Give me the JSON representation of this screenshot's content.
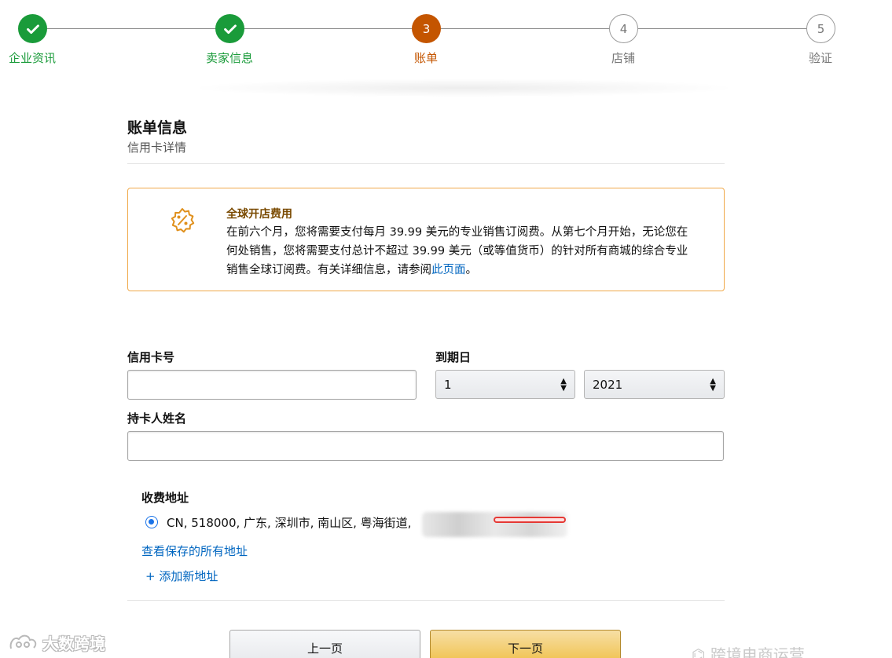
{
  "stepper": {
    "steps": [
      {
        "number": "1",
        "label": "企业资讯",
        "state": "done"
      },
      {
        "number": "2",
        "label": "卖家信息",
        "state": "done"
      },
      {
        "number": "3",
        "label": "账单",
        "state": "active"
      },
      {
        "number": "4",
        "label": "店铺",
        "state": "todo"
      },
      {
        "number": "5",
        "label": "验证",
        "state": "todo"
      }
    ],
    "colors": {
      "done": "#1a9b3a",
      "active": "#c45500",
      "todo": "#777777"
    }
  },
  "section": {
    "title": "账单信息",
    "subtitle": "信用卡详情"
  },
  "notice": {
    "icon": "badge-percent-icon",
    "title": "全球开店费用",
    "body": "在前六个月，您将需要支付每月 39.99 美元的专业销售订阅费。从第七个月开始，无论您在何处销售，您将需要支付总计不超过 39.99 美元（或等值货币）的针对所有商城的综合专业销售全球订阅费。有关详细信息，请参阅",
    "link_text": "此页面",
    "suffix": "。",
    "accent_color": "#f0a94a"
  },
  "form": {
    "card_number": {
      "label": "信用卡号",
      "value": ""
    },
    "expiry": {
      "label": "到期日",
      "month": "1",
      "year": "2021"
    },
    "holder_name": {
      "label": "持卡人姓名",
      "value": ""
    }
  },
  "billing": {
    "label": "收费地址",
    "address": "CN, 518000, 广东, 深圳市, 南山区, 粤海街道,",
    "view_all": "查看保存的所有地址",
    "add_new": "+ 添加新地址"
  },
  "buttons": {
    "prev": "上一页",
    "next": "下一页"
  },
  "watermarks": {
    "left": "大数跨境",
    "right": "跨境电商运营"
  }
}
